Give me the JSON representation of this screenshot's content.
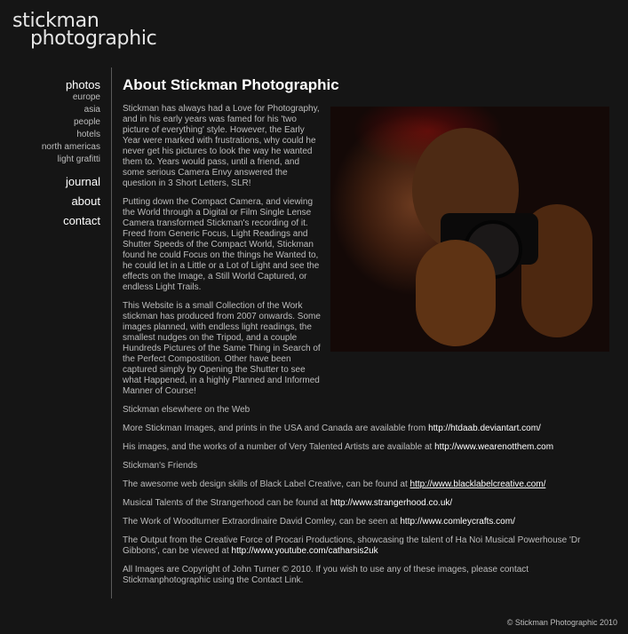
{
  "logo": {
    "line1": "stickman",
    "line2": "photographic"
  },
  "nav": {
    "photos": "photos",
    "subitems": [
      "europe",
      "asia",
      "people",
      "hotels",
      "north americas",
      "light grafitti"
    ],
    "journal": "journal",
    "about": "about",
    "contact": "contact"
  },
  "page": {
    "title": "About Stickman Photographic",
    "p1": "Stickman has always had a Love for Photography, and in his early years was famed for his 'two picture of everything' style. However, the Early Year were marked with frustrations, why could he never get his pictures to look the way he wanted them to. Years would pass, until a friend, and some serious Camera Envy answered the question in 3 Short Letters, SLR!",
    "p2": "Putting down the Compact Camera, and viewing the World through a Digital or Film Single Lense Camera transformed Stickman's recording of it. Freed from Generic Focus, Light Readings and Shutter Speeds of the Compact World, Stickman found he could Focus on the things he Wanted to, he could let in a Little or a Lot of Light and see the effects on the Image, a Still World Captured, or endless Light Trails.",
    "p3": "This Website is a small Collection of the Work stickman has produced from 2007 onwards. Some images planned, with endless light readings, the smallest nudges on the Tripod, and a couple Hundreds Pictures of the Same Thing in Search of the Perfect Compostition. Other have been captured simply by Opening the Shutter to see what Happened, in a highly Planned and Informed Manner of Course!",
    "elsewhere_heading": "Stickman elsewhere on the Web",
    "e1_text": "More Stickman Images, and prints in the USA and Canada are available from ",
    "e1_link": "http://htdaab.deviantart.com/",
    "e2_text": "His images, and the works of a number of Very Talented Artists are available at ",
    "e2_link": "http://www.wearenotthem.com",
    "friends_heading": "Stickman's Friends",
    "f1_text": "The awesome web design skills of Black Label Creative, can be found at ",
    "f1_link": "http://www.blacklabelcreative.com/",
    "f2_text": "Musical Talents of the Strangerhood can be found at ",
    "f2_link": "http://www.strangerhood.co.uk/",
    "f3_text": "The Work of Woodturner Extraordinaire David Comley, can be seen at ",
    "f3_link": "http://www.comleycrafts.com/",
    "f4_text": "The Output from the Creative Force of Procari Productions, showcasing the talent of Ha Noi Musical Powerhouse 'Dr Gibbons', can be viewed at ",
    "f4_link": "http://www.youtube.com/catharsis2uk",
    "copyright": "All Images are Copyright of John Turner © 2010. If you wish to use any of these images, please contact Stickmanphotographic using the Contact Link."
  },
  "footer": "© Stickman Photographic 2010"
}
